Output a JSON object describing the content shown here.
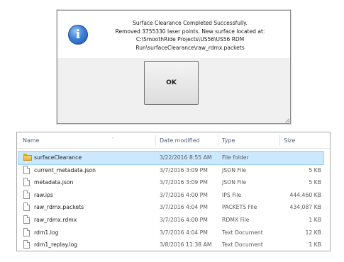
{
  "dialog": {
    "message_lines": [
      "Surface Clearance Completed Successfully.",
      "Removed 3755330 laser points. New surface located at:",
      "C:\\SmoothRide Projects\\US56\\US56 RDM",
      "Run\\surfaceClearance\\raw_rdmx.packets"
    ],
    "icon": "information-icon",
    "icon_glyph": "i",
    "ok_label": "OK"
  },
  "explorer": {
    "columns": {
      "name": "Name",
      "date": "Date modified",
      "type": "Type",
      "size": "Size"
    },
    "sort_indicator": "^",
    "files": [
      {
        "name": "surfaceClearance",
        "date": "3/22/2016 8:55 AM",
        "type": "File folder",
        "size": "",
        "icon": "folder-icon",
        "selected": true
      },
      {
        "name": "current_metadata.json",
        "date": "3/7/2016 3:09 PM",
        "type": "JSON File",
        "size": "5 KB",
        "icon": "file-icon",
        "selected": false
      },
      {
        "name": "metadata.json",
        "date": "3/7/2016 3:09 PM",
        "type": "JSON File",
        "size": "5 KB",
        "icon": "file-icon",
        "selected": false
      },
      {
        "name": "raw.ips",
        "date": "3/7/2016 4:00 PM",
        "type": "IPS File",
        "size": "444,460 KB",
        "icon": "file-icon",
        "selected": false
      },
      {
        "name": "raw_rdmx.packets",
        "date": "3/7/2016 4:04 PM",
        "type": "PACKETS File",
        "size": "434,087 KB",
        "icon": "file-icon",
        "selected": false
      },
      {
        "name": "raw_rdmx.rdmx",
        "date": "3/7/2016 4:00 PM",
        "type": "RDMX File",
        "size": "1 KB",
        "icon": "file-icon",
        "selected": false
      },
      {
        "name": "rdm1.log",
        "date": "3/7/2016 4:04 PM",
        "type": "Text Document",
        "size": "12 KB",
        "icon": "file-icon",
        "selected": false
      },
      {
        "name": "rdm1_replay.log",
        "date": "3/8/2016 11:38 AM",
        "type": "Text Document",
        "size": "1 KB",
        "icon": "file-icon",
        "selected": false
      }
    ]
  },
  "colors": {
    "selection_fill": "#cce8ff",
    "selection_border": "#99d1ff",
    "header_text": "#4c607a"
  }
}
